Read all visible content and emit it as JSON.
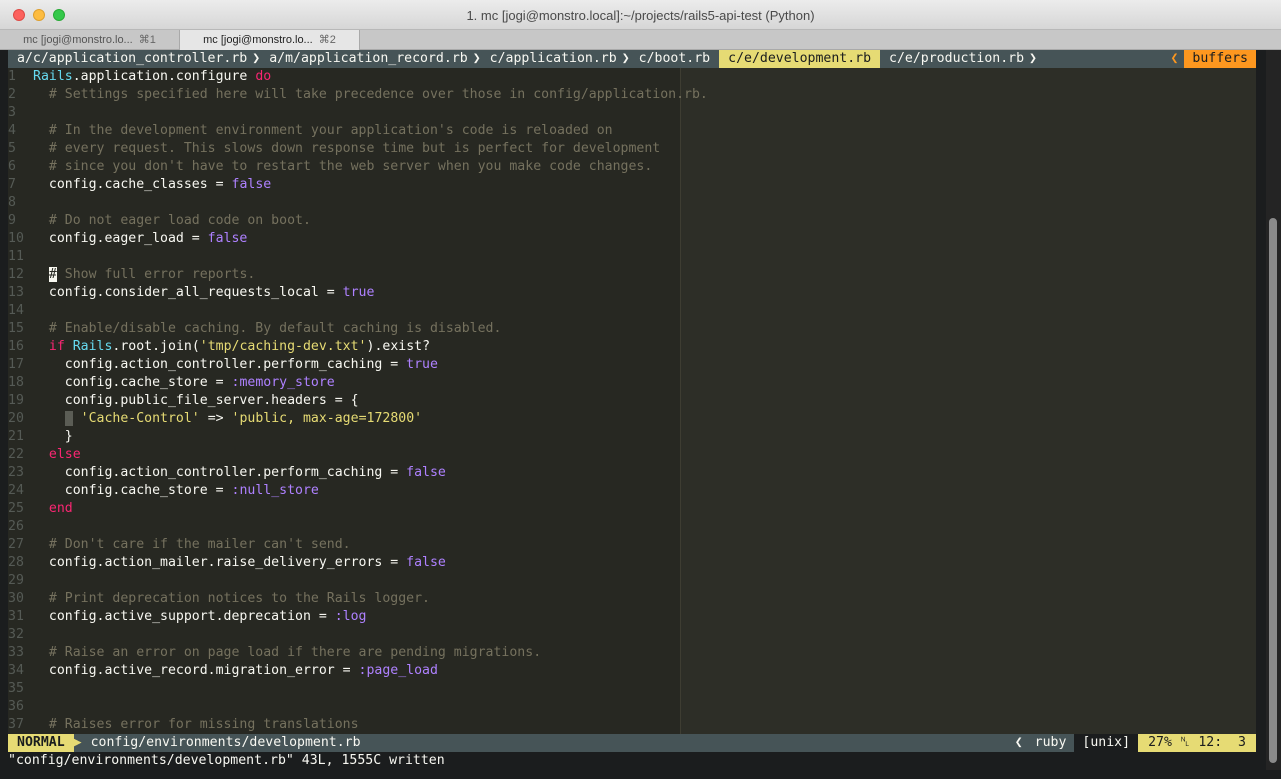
{
  "window": {
    "title": "1. mc [jogi@monstro.local]:~/projects/rails5-api-test (Python)"
  },
  "tabs": [
    {
      "label": "mc [jogi@monstro.lo...",
      "key": "⌘1"
    },
    {
      "label": "mc [jogi@monstro.lo...",
      "key": "⌘2"
    }
  ],
  "vim": {
    "buffers": [
      "a/c/application_controller.rb",
      "a/m/application_record.rb",
      "c/application.rb",
      "c/boot.rb",
      "c/e/development.rb",
      "c/e/production.rb"
    ],
    "current_buffer": "c/e/development.rb",
    "buffers_label": "buffers",
    "mode": "NORMAL",
    "filename": "config/environments/development.rb",
    "filetype": "ruby",
    "fileformat": "[unix]",
    "percent": "27%",
    "position": "12:  3",
    "message": "\"config/environments/development.rb\" 43L, 1555C written",
    "colors": {
      "background": "#272822",
      "comment": "#75715e",
      "keyword": "#f92672",
      "constant": "#66d9ef",
      "boolean": "#ae81ff",
      "string": "#e6db74",
      "mode_bg": "#e6db74",
      "buffers_bg": "#fd971f"
    }
  },
  "code": [
    {
      "n": "1",
      "t": [
        [
          "c-const",
          "Rails"
        ],
        [
          "",
          ".application.configure "
        ],
        [
          "c-key",
          "do"
        ]
      ]
    },
    {
      "n": "2",
      "t": [
        [
          "c-comment",
          "  # Settings specified here will take precedence over those in config/application.rb."
        ]
      ]
    },
    {
      "n": "3",
      "t": []
    },
    {
      "n": "4",
      "t": [
        [
          "c-comment",
          "  # In the development environment your application's code is reloaded on"
        ]
      ]
    },
    {
      "n": "5",
      "t": [
        [
          "c-comment",
          "  # every request. This slows down response time but is perfect for development"
        ]
      ]
    },
    {
      "n": "6",
      "t": [
        [
          "c-comment",
          "  # since you don't have to restart the web server when you make code changes."
        ]
      ]
    },
    {
      "n": "7",
      "t": [
        [
          "",
          "  config.cache_classes = "
        ],
        [
          "c-bool",
          "false"
        ]
      ]
    },
    {
      "n": "8",
      "t": []
    },
    {
      "n": "9",
      "t": [
        [
          "c-comment",
          "  # Do not eager load code on boot."
        ]
      ]
    },
    {
      "n": "10",
      "t": [
        [
          "",
          "  config.eager_load = "
        ],
        [
          "c-bool",
          "false"
        ]
      ]
    },
    {
      "n": "11",
      "t": []
    },
    {
      "n": "12",
      "t": [
        [
          "",
          "  "
        ],
        [
          "cursor",
          "#"
        ],
        [
          "c-comment",
          " Show full error reports."
        ]
      ]
    },
    {
      "n": "13",
      "t": [
        [
          "",
          "  config.consider_all_requests_local = "
        ],
        [
          "c-bool",
          "true"
        ]
      ]
    },
    {
      "n": "14",
      "t": []
    },
    {
      "n": "15",
      "t": [
        [
          "c-comment",
          "  # Enable/disable caching. By default caching is disabled."
        ]
      ]
    },
    {
      "n": "16",
      "t": [
        [
          "",
          "  "
        ],
        [
          "c-key",
          "if"
        ],
        [
          "",
          ""
        ],
        [
          "c-const",
          " Rails"
        ],
        [
          "",
          ".root.join("
        ],
        [
          "c-str",
          "'tmp/caching-dev.txt'"
        ],
        [
          "",
          ").exist?"
        ]
      ]
    },
    {
      "n": "17",
      "t": [
        [
          "",
          "    config.action_controller.perform_caching = "
        ],
        [
          "c-bool",
          "true"
        ]
      ]
    },
    {
      "n": "18",
      "t": [
        [
          "",
          "    config.cache_store = "
        ],
        [
          "c-bool",
          ":memory_store"
        ]
      ]
    },
    {
      "n": "19",
      "t": [
        [
          "",
          "    config.public_file_server.headers = {"
        ]
      ]
    },
    {
      "n": "20",
      "t": [
        [
          "",
          "    "
        ],
        [
          "indent-guide",
          " "
        ],
        [
          "c-str",
          " 'Cache-Control'"
        ],
        [
          "",
          " => "
        ],
        [
          "c-str",
          "'public, max-age=172800'"
        ]
      ]
    },
    {
      "n": "21",
      "t": [
        [
          "",
          "    }"
        ]
      ]
    },
    {
      "n": "22",
      "t": [
        [
          "",
          "  "
        ],
        [
          "c-key",
          "else"
        ]
      ]
    },
    {
      "n": "23",
      "t": [
        [
          "",
          "    config.action_controller.perform_caching = "
        ],
        [
          "c-bool",
          "false"
        ]
      ]
    },
    {
      "n": "24",
      "t": [
        [
          "",
          "    config.cache_store = "
        ],
        [
          "c-bool",
          ":null_store"
        ]
      ]
    },
    {
      "n": "25",
      "t": [
        [
          "",
          "  "
        ],
        [
          "c-key",
          "end"
        ]
      ]
    },
    {
      "n": "26",
      "t": []
    },
    {
      "n": "27",
      "t": [
        [
          "c-comment",
          "  # Don't care if the mailer can't send."
        ]
      ]
    },
    {
      "n": "28",
      "t": [
        [
          "",
          "  config.action_mailer.raise_delivery_errors = "
        ],
        [
          "c-bool",
          "false"
        ]
      ]
    },
    {
      "n": "29",
      "t": []
    },
    {
      "n": "30",
      "t": [
        [
          "c-comment",
          "  # Print deprecation notices to the Rails logger."
        ]
      ]
    },
    {
      "n": "31",
      "t": [
        [
          "",
          "  config.active_support.deprecation = "
        ],
        [
          "c-bool",
          ":log"
        ]
      ]
    },
    {
      "n": "32",
      "t": []
    },
    {
      "n": "33",
      "t": [
        [
          "c-comment",
          "  # Raise an error on page load if there are pending migrations."
        ]
      ]
    },
    {
      "n": "34",
      "t": [
        [
          "",
          "  config.active_record.migration_error = "
        ],
        [
          "c-bool",
          ":page_load"
        ]
      ]
    },
    {
      "n": "35",
      "t": []
    },
    {
      "n": "36",
      "t": []
    },
    {
      "n": "37",
      "t": [
        [
          "c-comment",
          "  # Raises error for missing translations"
        ]
      ]
    }
  ]
}
